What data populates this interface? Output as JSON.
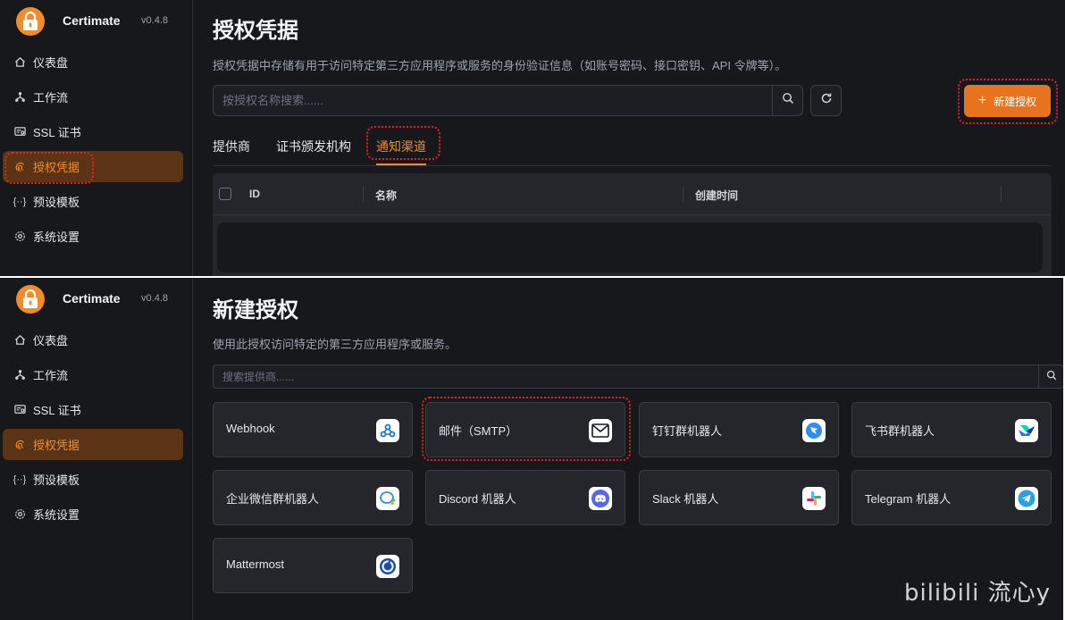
{
  "app": {
    "name": "Certimate",
    "version": "v0.4.8"
  },
  "sidebar": {
    "items": [
      {
        "label": "仪表盘",
        "icon": "home-icon"
      },
      {
        "label": "工作流",
        "icon": "workflow-icon"
      },
      {
        "label": "SSL 证书",
        "icon": "certificate-icon"
      },
      {
        "label": "授权凭据",
        "icon": "fingerprint-icon",
        "active": true
      },
      {
        "label": "预设模板",
        "icon": "braces-icon"
      },
      {
        "label": "系统设置",
        "icon": "gear-icon"
      }
    ]
  },
  "access_page": {
    "title": "授权凭据",
    "description": "授权凭据中存储有用于访问特定第三方应用程序或服务的身份验证信息（如账号密码、接口密钥、API 令牌等）。",
    "search_placeholder": "按授权名称搜索......",
    "new_button": "新建授权",
    "tabs": [
      "提供商",
      "证书颁发机构",
      "通知渠道"
    ],
    "active_tab": "通知渠道",
    "table_headers": [
      "ID",
      "名称",
      "创建时间"
    ]
  },
  "new_access_page": {
    "title": "新建授权",
    "description": "使用此授权访问特定的第三方应用程序或服务。",
    "search_placeholder": "搜索提供商......",
    "providers": [
      {
        "label": "Webhook",
        "icon": "webhook-icon",
        "color": "#1f6fd6"
      },
      {
        "label": "邮件（SMTP）",
        "icon": "mail-icon",
        "color": "#ffffff"
      },
      {
        "label": "钉钉群机器人",
        "icon": "dingtalk-icon",
        "color": "#2e8ef0"
      },
      {
        "label": "飞书群机器人",
        "icon": "feishu-icon",
        "color": "#ffffff"
      },
      {
        "label": "企业微信群机器人",
        "icon": "wecom-icon",
        "color": "#ffffff"
      },
      {
        "label": "Discord 机器人",
        "icon": "discord-icon",
        "color": "#5865f2"
      },
      {
        "label": "Slack 机器人",
        "icon": "slack-icon",
        "color": "#ffffff"
      },
      {
        "label": "Telegram 机器人",
        "icon": "telegram-icon",
        "color": "#2aa3dc"
      },
      {
        "label": "Mattermost",
        "icon": "mattermost-icon",
        "color": "#1e4fa8"
      }
    ]
  },
  "watermark": "bilibili 流心y",
  "colors": {
    "accent": "#e8731f",
    "highlight": "#e02424",
    "background": "#17181c"
  }
}
